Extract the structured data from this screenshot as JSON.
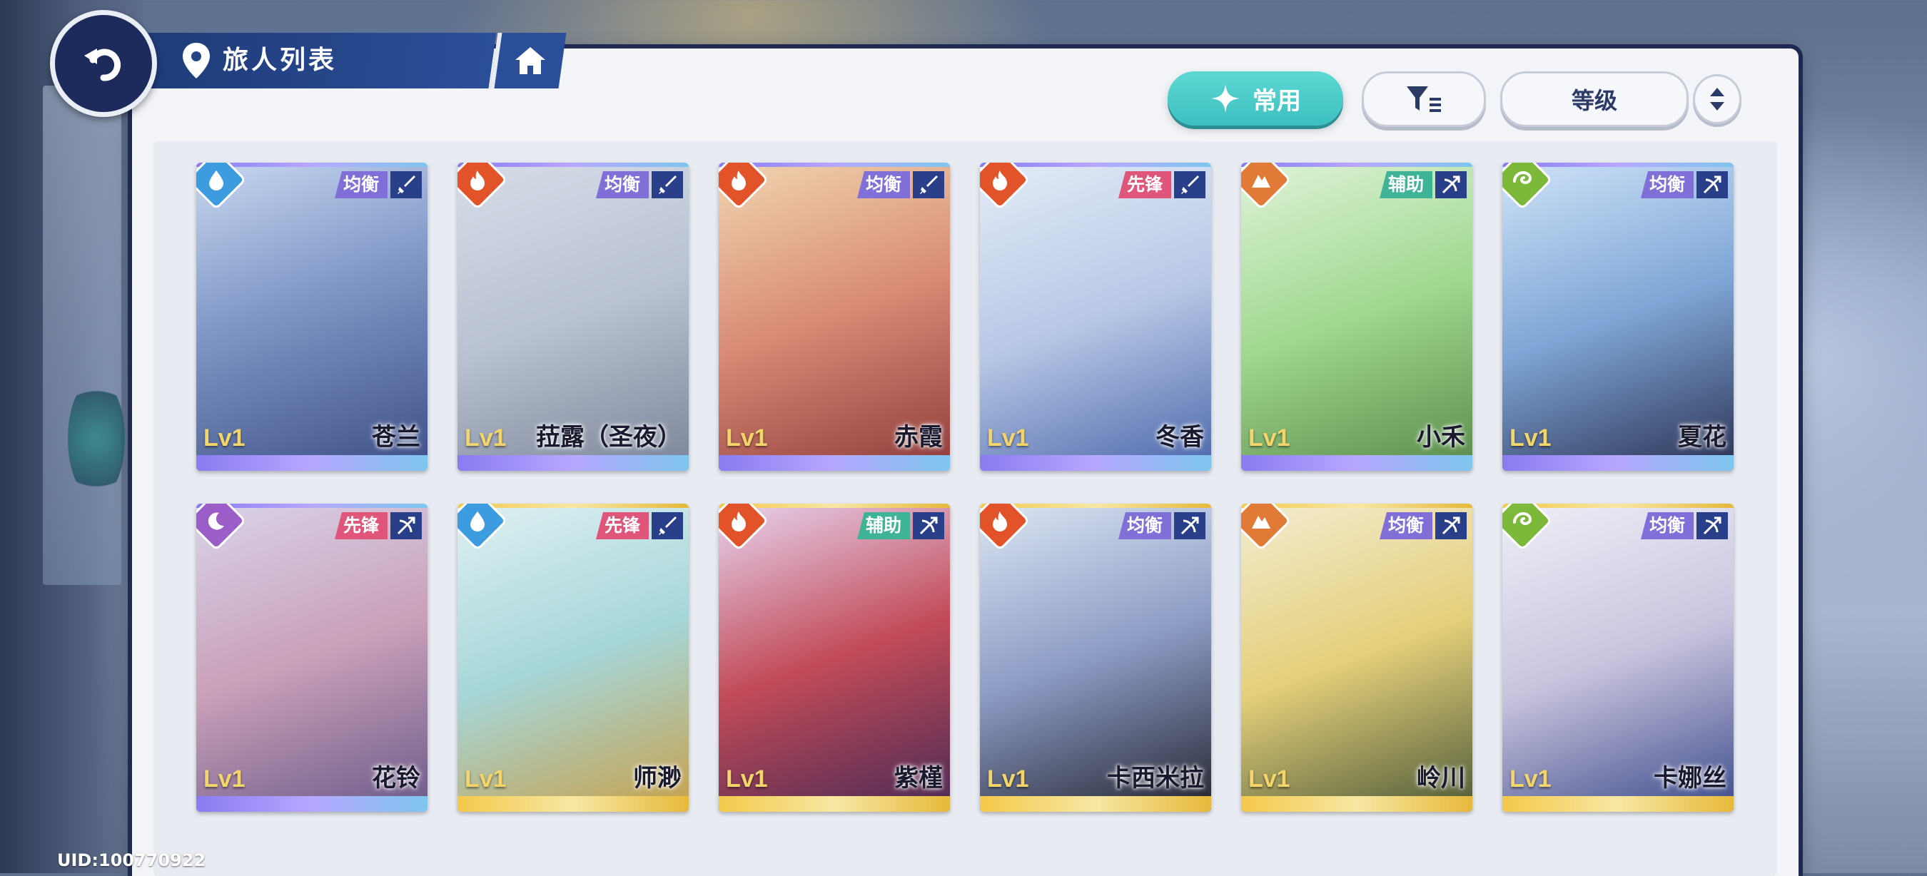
{
  "header": {
    "title": "旅人列表",
    "back_icon": "back-arrow-icon",
    "location_icon": "location-pin-icon",
    "home_icon": "home-icon"
  },
  "toolbar": {
    "common_label": "常用",
    "common_icon": "sparkle-icon",
    "filter_icon": "filter-icon",
    "sort_label": "等级",
    "order_icon": "sort-order-icon"
  },
  "colors": {
    "accent": "#3cbfc0",
    "brand_dark": "#1f3b78",
    "water": "#3d9be0",
    "fire": "#e2532a",
    "earth": "#e07a36",
    "wind": "#7cb839",
    "moon": "#9b5ec9",
    "role_balance": "#7f6fd6",
    "role_vanguard": "#e0567a",
    "role_support": "#3fb395"
  },
  "cards": [
    {
      "name": "苍兰",
      "level": "Lv1",
      "role": "均衡",
      "element": "water",
      "weapon": "sword-icon",
      "rarity": "purple"
    },
    {
      "name": "菈露（圣夜）",
      "level": "Lv1",
      "role": "均衡",
      "element": "fire",
      "weapon": "sword-icon",
      "rarity": "purple"
    },
    {
      "name": "赤霞",
      "level": "Lv1",
      "role": "均衡",
      "element": "fire",
      "weapon": "sword-icon",
      "rarity": "purple"
    },
    {
      "name": "冬香",
      "level": "Lv1",
      "role": "先锋",
      "element": "fire",
      "weapon": "sword-icon",
      "rarity": "purple"
    },
    {
      "name": "小禾",
      "level": "Lv1",
      "role": "辅助",
      "element": "earth",
      "weapon": "bow-icon",
      "rarity": "purple"
    },
    {
      "name": "夏花",
      "level": "Lv1",
      "role": "均衡",
      "element": "wind",
      "weapon": "bow-icon",
      "rarity": "purple"
    },
    {
      "name": "花铃",
      "level": "Lv1",
      "role": "先锋",
      "element": "moon",
      "weapon": "bow-icon",
      "rarity": "purple"
    },
    {
      "name": "师渺",
      "level": "Lv1",
      "role": "先锋",
      "element": "water",
      "weapon": "sword-icon",
      "rarity": "gold"
    },
    {
      "name": "紫槿",
      "level": "Lv1",
      "role": "辅助",
      "element": "fire",
      "weapon": "bow-icon",
      "rarity": "gold"
    },
    {
      "name": "卡西米拉",
      "level": "Lv1",
      "role": "均衡",
      "element": "fire",
      "weapon": "bow-icon",
      "rarity": "gold"
    },
    {
      "name": "岭川",
      "level": "Lv1",
      "role": "均衡",
      "element": "earth",
      "weapon": "bow-icon",
      "rarity": "gold"
    },
    {
      "name": "卡娜丝",
      "level": "Lv1",
      "role": "均衡",
      "element": "wind",
      "weapon": "bow-icon",
      "rarity": "gold"
    }
  ],
  "footer": {
    "uid": "UID:100770922"
  }
}
